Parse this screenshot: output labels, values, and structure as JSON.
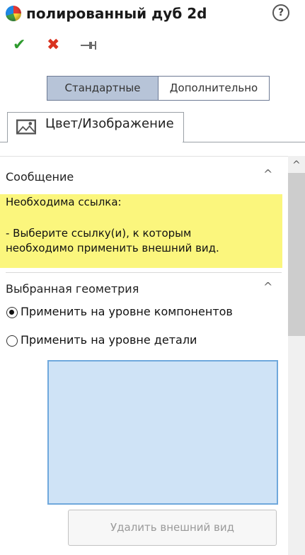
{
  "header": {
    "title": "полированный дуб 2d",
    "help_symbol": "?",
    "ok_symbol": "✔",
    "cancel_symbol": "✖"
  },
  "tabs": [
    {
      "label": "Стандартные",
      "active": true
    },
    {
      "label": "Дополнительно",
      "active": false
    }
  ],
  "property_tab": {
    "label": "Цвет/Изображение",
    "icon": "image-icon"
  },
  "message_section": {
    "title": "Сообщение",
    "lines": [
      "Необходима ссылка:",
      "",
      "- Выберите ссылку(и), к которым",
      "необходимо применить внешний вид."
    ],
    "background": "#fbf67d"
  },
  "geometry_section": {
    "title": "Выбранная геометрия",
    "options": [
      {
        "label": "Применить на уровне компонентов",
        "checked": true
      },
      {
        "label": "Применить на уровне детали",
        "checked": false
      }
    ],
    "selection_box_color": "#cfe3f6"
  },
  "remove_button": {
    "label": "Удалить внешний вид",
    "enabled": false
  },
  "icons": {
    "caret": "^"
  },
  "colors": {
    "accent_tab": "#b7c4d8",
    "ok": "#2e9b2e",
    "cancel": "#d9321f"
  }
}
